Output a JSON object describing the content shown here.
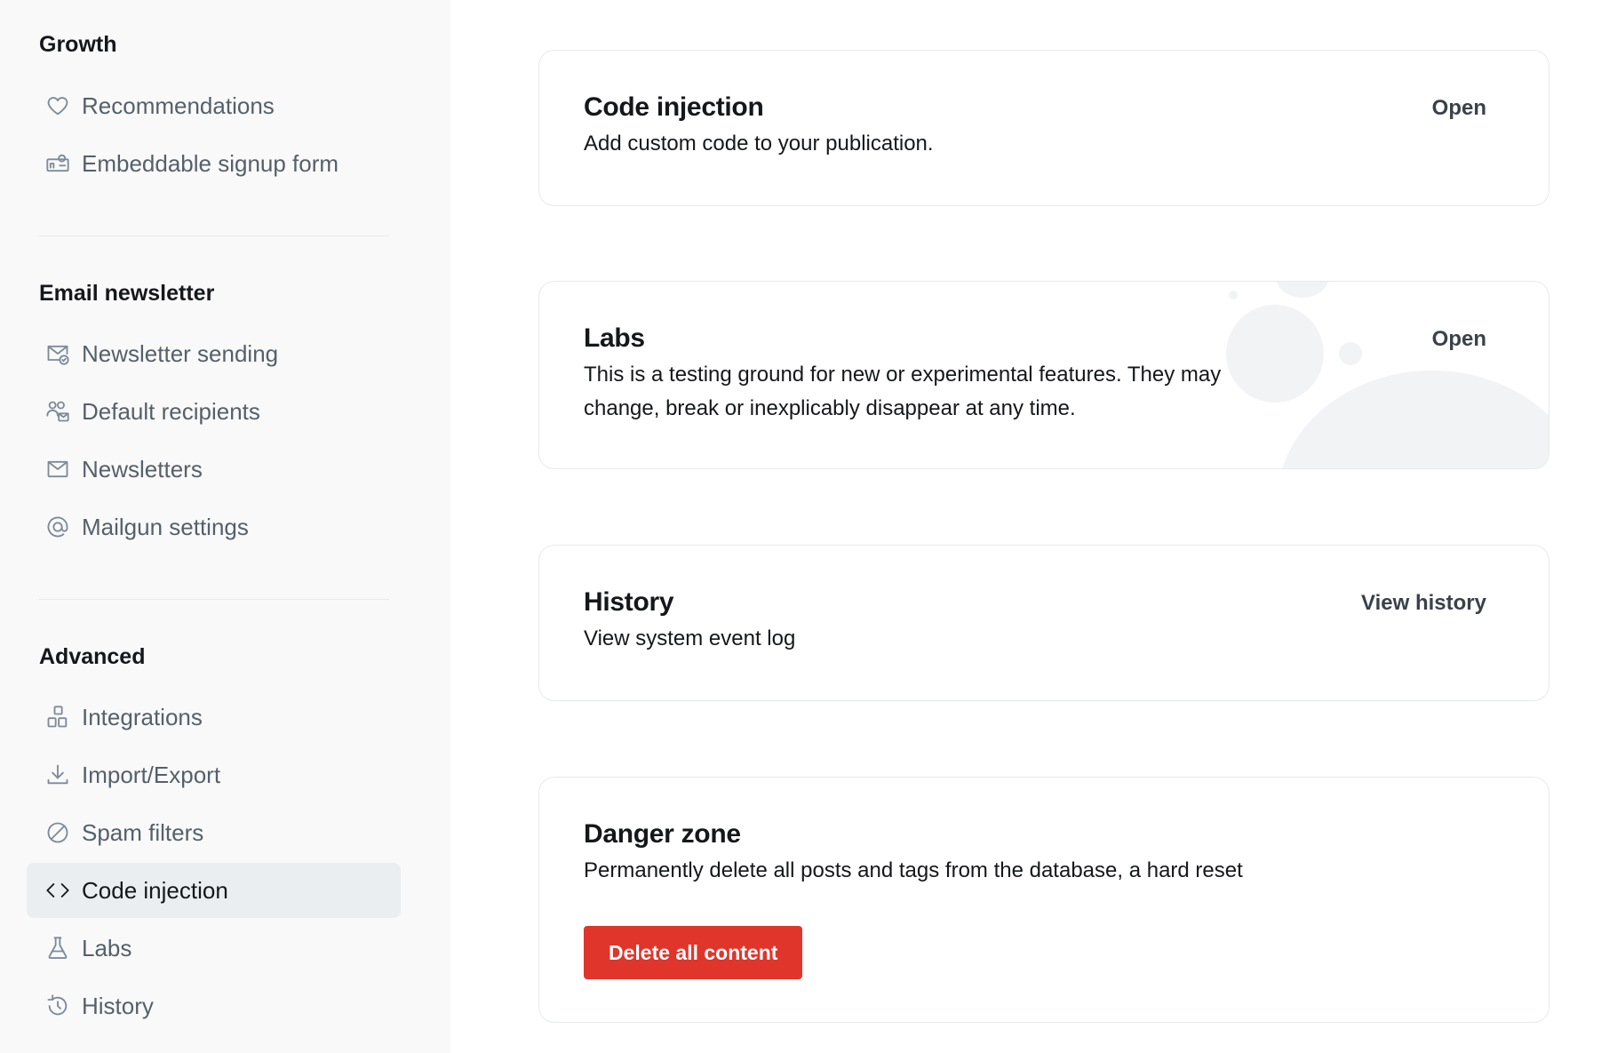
{
  "sidebar": {
    "growth": {
      "title": "Growth",
      "items": [
        {
          "label": "Recommendations",
          "icon": "heart-icon"
        },
        {
          "label": "Embeddable signup form",
          "icon": "signup-form-icon"
        }
      ]
    },
    "email": {
      "title": "Email newsletter",
      "items": [
        {
          "label": "Newsletter sending",
          "icon": "mail-check-icon"
        },
        {
          "label": "Default recipients",
          "icon": "users-icon"
        },
        {
          "label": "Newsletters",
          "icon": "envelope-icon"
        },
        {
          "label": "Mailgun settings",
          "icon": "at-icon"
        }
      ]
    },
    "advanced": {
      "title": "Advanced",
      "items": [
        {
          "label": "Integrations",
          "icon": "blocks-icon"
        },
        {
          "label": "Import/Export",
          "icon": "download-icon"
        },
        {
          "label": "Spam filters",
          "icon": "block-icon"
        },
        {
          "label": "Code injection",
          "icon": "code-icon",
          "active": true
        },
        {
          "label": "Labs",
          "icon": "flask-icon"
        },
        {
          "label": "History",
          "icon": "history-icon"
        }
      ]
    }
  },
  "main": {
    "code_injection": {
      "title": "Code injection",
      "description": "Add custom code to your publication.",
      "action": "Open"
    },
    "labs": {
      "title": "Labs",
      "description": "This is a testing ground for new or experimental features. They may change, break or inexplicably disappear at any time.",
      "action": "Open"
    },
    "history": {
      "title": "History",
      "description": "View system event log",
      "action": "View history"
    },
    "danger": {
      "title": "Danger zone",
      "description": "Permanently delete all posts and tags from the database, a hard reset",
      "button": "Delete all content"
    }
  },
  "colors": {
    "danger": "#e0352b",
    "sidebar_bg": "#f9f9f9",
    "active_bg": "#ebeef0"
  }
}
